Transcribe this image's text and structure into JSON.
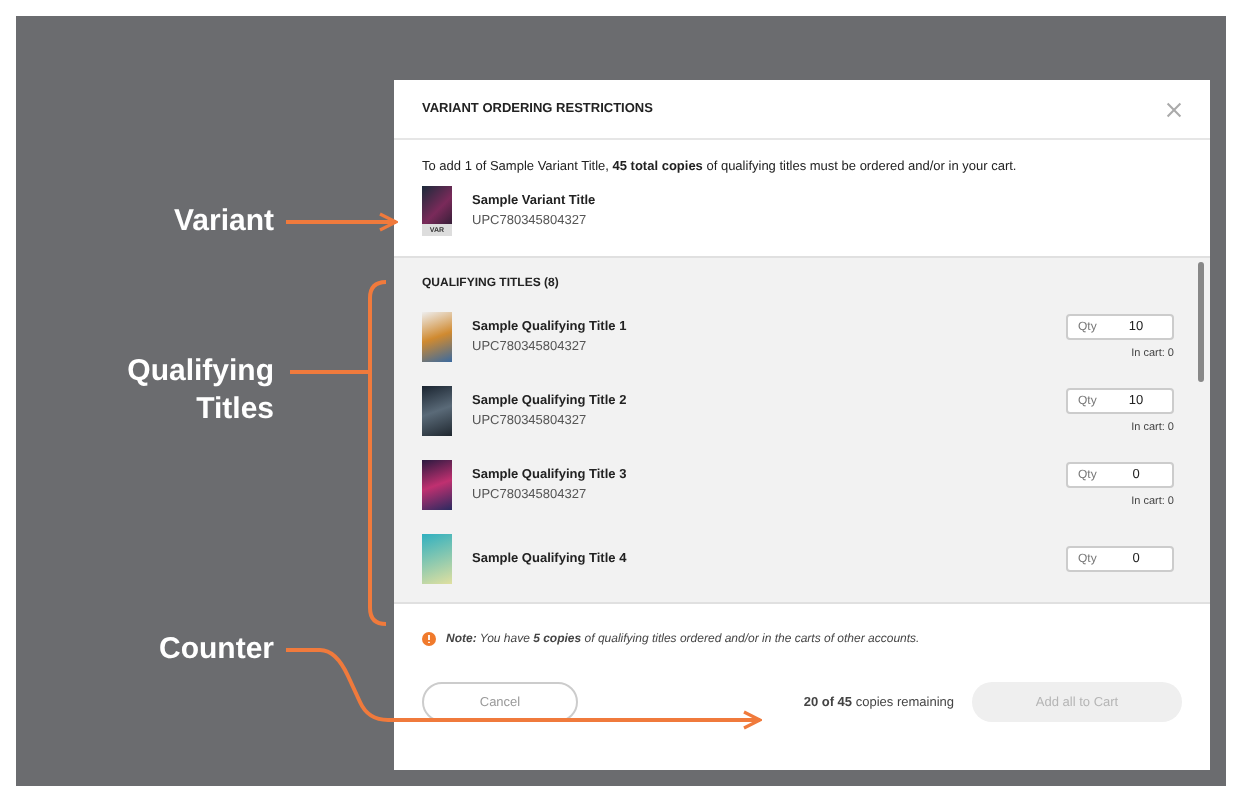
{
  "annotations": [
    {
      "kind": "arrow",
      "label": "Variant"
    },
    {
      "kind": "bracket",
      "label": "Qualifying Titles"
    },
    {
      "kind": "elbow",
      "label": "Counter"
    }
  ],
  "modal": {
    "title": "VARIANT ORDERING RESTRICTIONS",
    "intro": "To add 1 of Sample Variant Title, **45 total copies** of qualifying titles must be ordered and/or in your cart.",
    "variant": {
      "title": "Sample Variant Title",
      "upc": "UPC780345804327",
      "tag": "VAR"
    },
    "qualifying": {
      "heading": "QUALIFYING TITLES (8)",
      "items": [
        {
          "title": "Sample Qualifying Title 1",
          "upc": "UPC780345804327",
          "qty_label": "Qty",
          "qty": "10",
          "in_cart": "In cart: 0"
        },
        {
          "title": "Sample Qualifying Title 2",
          "upc": "UPC780345804327",
          "qty_label": "Qty",
          "qty": "10",
          "in_cart": "In cart: 0"
        },
        {
          "title": "Sample Qualifying Title 3",
          "upc": "UPC780345804327",
          "qty_label": "Qty",
          "qty": "0",
          "in_cart": "In cart: 0"
        },
        {
          "title": "Sample Qualifying Title 4",
          "qty_label": "Qty",
          "qty": "0"
        }
      ]
    },
    "note": "**Note:** You have **5 copies** of qualifying titles ordered and/or in the carts of other accounts.",
    "counter": "**20 of 45** copies remaining",
    "buttons": [
      {
        "kind": "secondary",
        "label": "Cancel",
        "disabled": false
      },
      {
        "kind": "primary",
        "label": "Add all to Cart",
        "disabled": true
      }
    ]
  }
}
